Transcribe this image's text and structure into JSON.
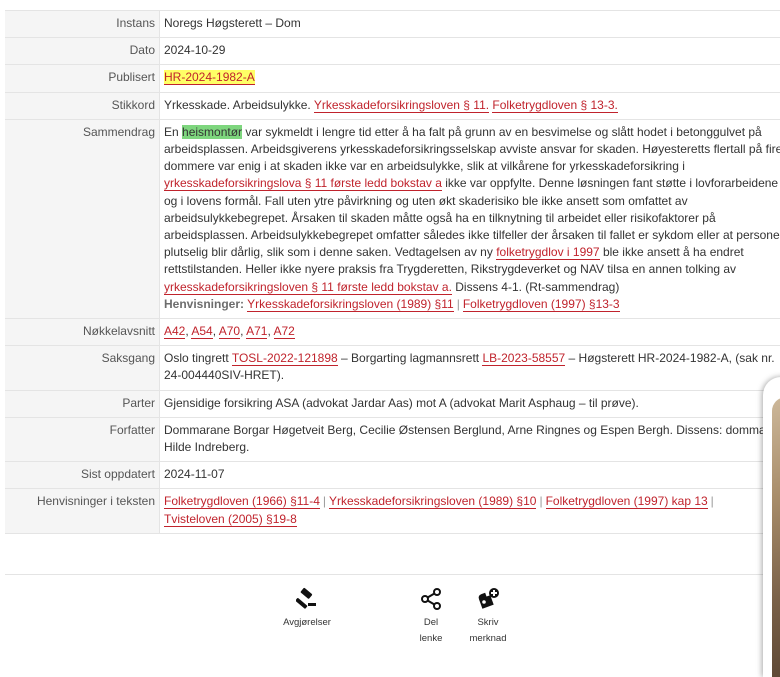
{
  "rows": {
    "instans": {
      "label": "Instans",
      "value": "Noregs Høgsterett – Dom"
    },
    "dato": {
      "label": "Dato",
      "value": "2024-10-29"
    },
    "publisert": {
      "label": "Publisert",
      "value": "HR-2024-1982-A"
    },
    "stikkord": {
      "label": "Stikkord",
      "text": "Yrkesskade. Arbeidsulykke.",
      "link1": "Yrkesskadeforsikringsloven § 11.",
      "link2": "Folketrygdloven § 13-3."
    },
    "sammendrag": {
      "label": "Sammendrag",
      "p1": "En",
      "hl": "heismontør",
      "p2": "var sykmeldt i lengre tid etter å ha falt på grunn av en besvimelse og slått hodet i betonggulvet på arbeidsplassen. Arbeidsgiverens yrkesskadeforsikringsselskap avviste ansvar for skaden. Høyesteretts flertall på fire dommere var enig i at skaden ikke var en arbeidsulykke, slik at vilkårene for yrkesskadeforsikring i",
      "link1": "yrkesskadeforsikringslova § 11 første ledd bokstav a",
      "p3": "ikke var oppfylte. Denne løsningen fant støtte i lovforarbeidene og i lovens formål. Fall uten ytre påvirkning og uten økt skaderisiko ble ikke ansett som omfattet av arbeidsulykkebegrepet. Årsaken til skaden måtte også ha en tilknytning til arbeidet eller risikofaktorer på arbeidsplassen. Arbeidsulykkebegrepet omfatter således ikke tilfeller der årsaken til fallet er sykdom eller at personen plutselig blir dårlig, slik som i denne saken. Vedtagelsen av ny",
      "link2": "folketrygdlov i 1997",
      "p4": "ble ikke ansett å ha endret rettstilstanden. Heller ikke nyere praksis fra Trygderetten, Rikstrygdeverket og NAV tilsa en annen tolking av",
      "link3": "yrkesskadeforsikringsloven § 11 første ledd bokstav a.",
      "p5": "Dissens 4-1. (Rt-sammendrag)",
      "henv_label": "Henvisninger:",
      "henv1": "Yrkesskadeforsikringsloven (1989) §11",
      "henv2": "Folketrygdloven (1997) §13-3"
    },
    "nokkelavsnitt": {
      "label": "Nøkkelavsnitt",
      "items": [
        "A42",
        "A54",
        "A70",
        "A71",
        "A72"
      ]
    },
    "saksgang": {
      "label": "Saksgang",
      "p1": "Oslo tingrett",
      "link1": "TOSL-2022-121898",
      "p2": "– Borgarting lagmannsrett",
      "link2": "LB-2023-58557",
      "p3": "– Høgsterett HR-2024-1982-A, (sak nr. 24-004440SIV-HRET)."
    },
    "parter": {
      "label": "Parter",
      "value": "Gjensidige forsikring ASA (advokat Jardar Aas) mot A (advokat Marit Asphaug – til prøve)."
    },
    "forfatter": {
      "label": "Forfatter",
      "value": "Dommarane Borgar Høgetveit Berg, Cecilie Østensen Berglund, Arne Ringnes og Espen Bergh. Dissens: dommar Hilde Indreberg."
    },
    "sist": {
      "label": "Sist oppdatert",
      "value": "2024-11-07"
    },
    "henvtekst": {
      "label": "Henvisninger i teksten",
      "items": [
        "Folketrygdloven (1966) §11-4",
        "Yrkesskadeforsikringsloven (1989) §10",
        "Folketrygdloven (1997) kap 13",
        "Tvisteloven (2005) §19-8"
      ]
    }
  },
  "actions": {
    "avgjorelser": "Avgjørelser",
    "del_line1": "Del",
    "del_line2": "lenke",
    "skriv_line1": "Skriv",
    "skriv_line2": "merknad"
  },
  "icons": [
    "gavel-icon",
    "share-icon",
    "add-note-icon"
  ]
}
